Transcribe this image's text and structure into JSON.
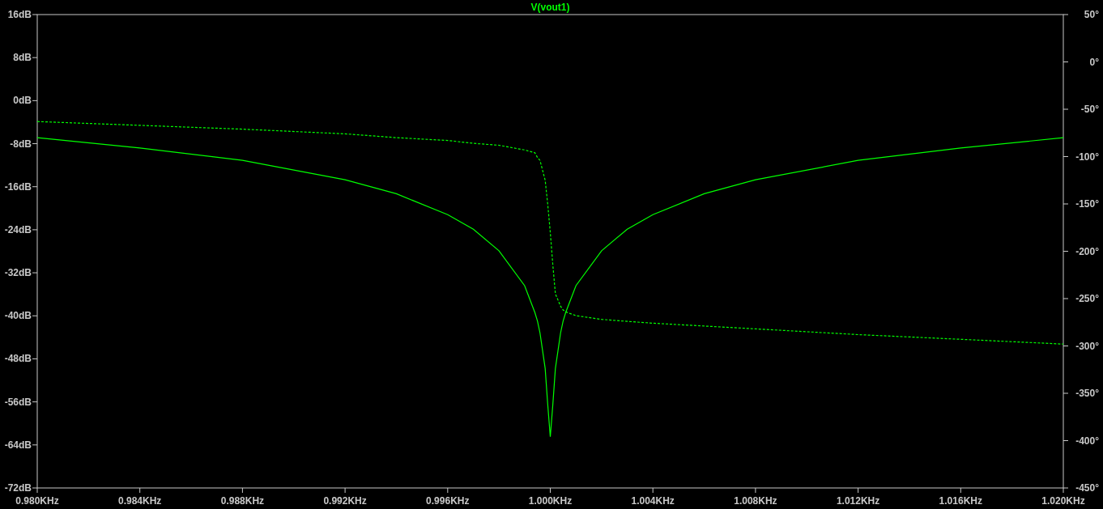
{
  "plot": {
    "chart_data": {
      "type": "line",
      "title": "V(vout1)",
      "x": [
        0.98,
        0.984,
        0.988,
        0.992,
        0.994,
        0.996,
        0.997,
        0.998,
        0.999,
        0.9994,
        0.9995,
        0.9996,
        0.9998,
        0.9999,
        1.0,
        1.0001,
        1.0002,
        1.0004,
        1.0005,
        1.0006,
        1.001,
        1.002,
        1.003,
        1.004,
        1.006,
        1.008,
        1.012,
        1.016,
        1.02
      ],
      "series": [
        {
          "color": "#00ff00",
          "line_style": "solid",
          "values": [
            -6.9,
            -8.8,
            -11.1,
            -14.7,
            -17.3,
            -21.2,
            -23.9,
            -27.9,
            -34.4,
            -39.4,
            -41.0,
            -43.2,
            -49.8,
            -56.4,
            -62.5,
            -56.4,
            -49.8,
            -43.2,
            -41.0,
            -39.4,
            -34.4,
            -27.9,
            -23.9,
            -21.2,
            -17.3,
            -14.7,
            -11.1,
            -8.8,
            -6.9
          ]
        },
        {
          "color": "#00ff00",
          "axis": "y2",
          "line_style": "dashed",
          "values": [
            -63,
            -67,
            -71,
            -76,
            -80,
            -83,
            -86,
            -88,
            -93,
            -96,
            -101,
            -104,
            -125,
            -150,
            -180,
            -215,
            -245,
            -258,
            -262,
            -264,
            -268,
            -272,
            -274,
            -276,
            -279,
            -282,
            -288,
            -293,
            -298
          ]
        }
      ],
      "xlim": [
        0.98,
        1.02
      ],
      "ylim": [
        -72,
        16
      ],
      "xticks": [
        {
          "value": 0.98,
          "label": "0.980KHz"
        },
        {
          "value": 0.984,
          "label": "0.984KHz"
        },
        {
          "value": 0.988,
          "label": "0.988KHz"
        },
        {
          "value": 0.992,
          "label": "0.992KHz"
        },
        {
          "value": 0.996,
          "label": "0.996KHz"
        },
        {
          "value": 1.0,
          "label": "1.000KHz"
        },
        {
          "value": 1.004,
          "label": "1.004KHz"
        },
        {
          "value": 1.008,
          "label": "1.008KHz"
        },
        {
          "value": 1.012,
          "label": "1.012KHz"
        },
        {
          "value": 1.016,
          "label": "1.016KHz"
        },
        {
          "value": 1.02,
          "label": "1.020KHz"
        }
      ],
      "yticks": [
        {
          "value": 16,
          "label": "16dB"
        },
        {
          "value": 8,
          "label": "8dB"
        },
        {
          "value": 0,
          "label": "0dB"
        },
        {
          "value": -8,
          "label": "-8dB"
        },
        {
          "value": -16,
          "label": "-16dB"
        },
        {
          "value": -24,
          "label": "-24dB"
        },
        {
          "value": -32,
          "label": "-32dB"
        },
        {
          "value": -40,
          "label": "-40dB"
        },
        {
          "value": -48,
          "label": "-48dB"
        },
        {
          "value": -56,
          "label": "-56dB"
        },
        {
          "value": -64,
          "label": "-64dB"
        },
        {
          "value": -72,
          "label": "-72dB"
        }
      ],
      "y2lim": [
        -450,
        50
      ],
      "y2ticks": [
        {
          "value": 50,
          "label": "50°"
        },
        {
          "value": 0,
          "label": "0°"
        },
        {
          "value": -50,
          "label": "-50°"
        },
        {
          "value": -100,
          "label": "-100°"
        },
        {
          "value": -150,
          "label": "-150°"
        },
        {
          "value": -200,
          "label": "-200°"
        },
        {
          "value": -250,
          "label": "-250°"
        },
        {
          "value": -300,
          "label": "-300°"
        },
        {
          "value": -350,
          "label": "-350°"
        },
        {
          "value": -400,
          "label": "-400°"
        },
        {
          "value": -450,
          "label": "-450°"
        }
      ]
    }
  }
}
